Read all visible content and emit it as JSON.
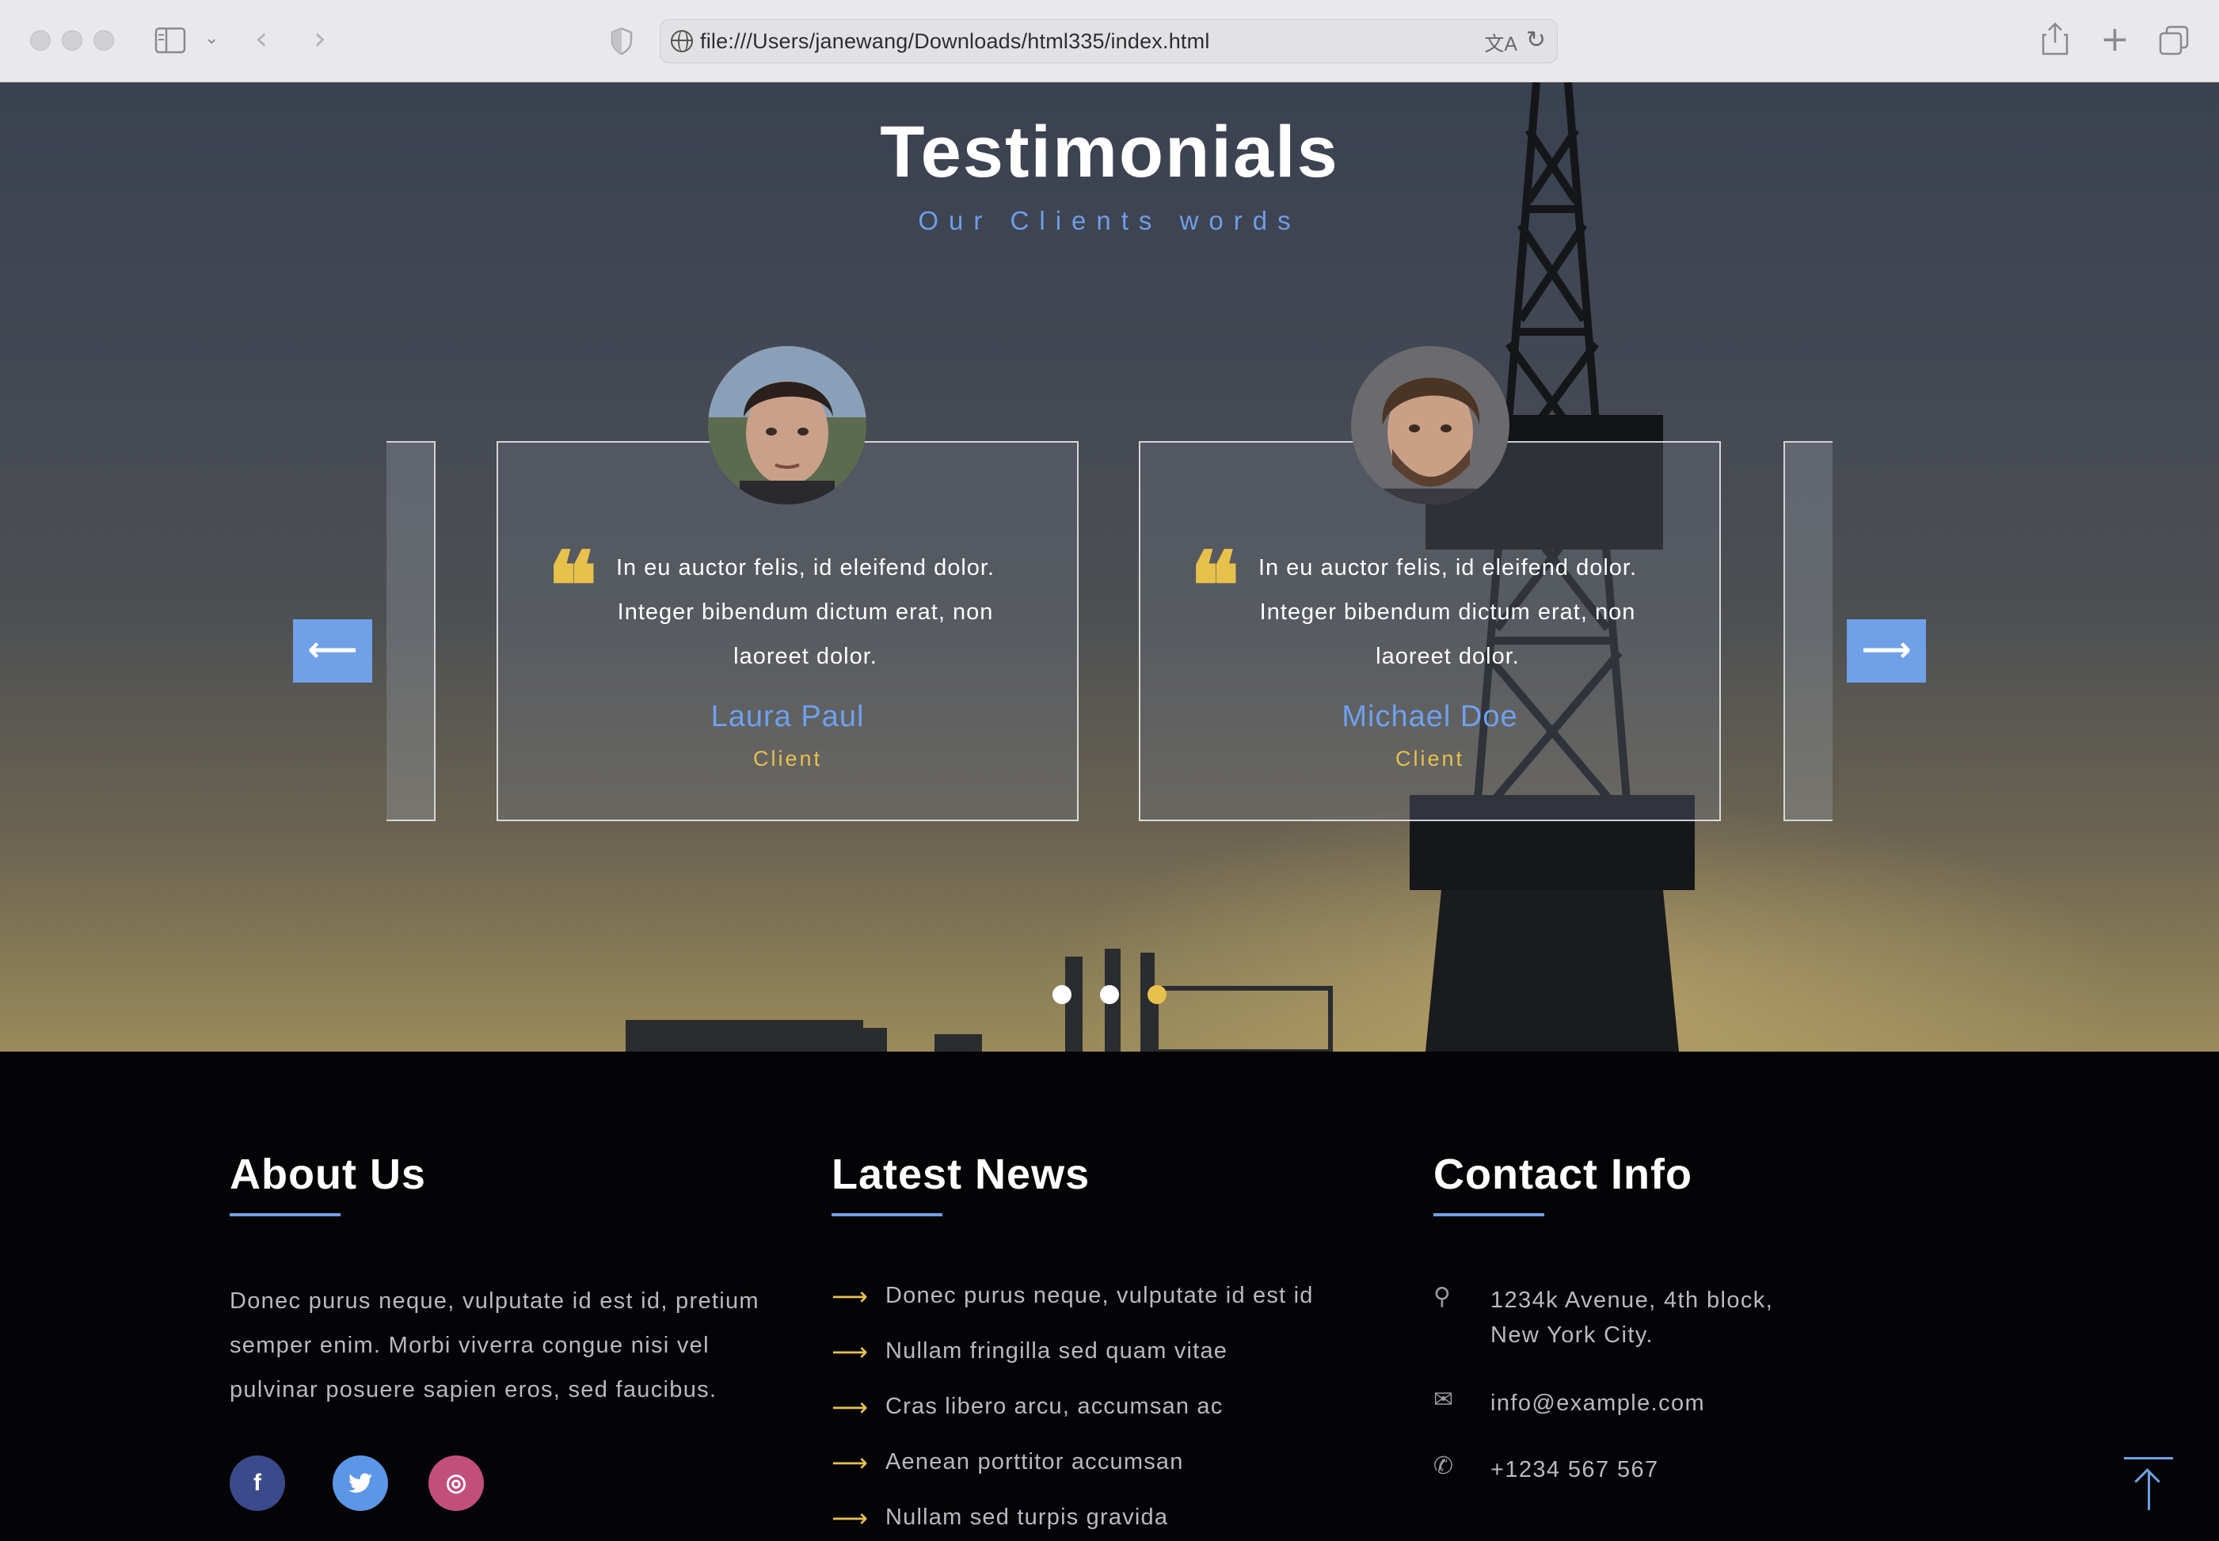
{
  "browser": {
    "url": "file:///Users/janewang/Downloads/html335/index.html"
  },
  "testimonials": {
    "title": "Testimonials",
    "subtitle": "Our Clients words",
    "prev_arrow": "⟵",
    "next_arrow": "⟶",
    "quote_glyph": "❝",
    "items": [
      {
        "text": "In eu auctor felis, id eleifend dolor. Integer bibendum dictum erat, non laoreet dolor.",
        "name": "Laura Paul",
        "role": "Client"
      },
      {
        "text": "In eu auctor felis, id eleifend dolor. Integer bibendum dictum erat, non laoreet dolor.",
        "name": "Michael Doe",
        "role": "Client"
      }
    ],
    "dots_total": 3,
    "dots_active_index": 2
  },
  "footer": {
    "about": {
      "title": "About Us",
      "text": "Donec purus neque, vulputate id est id, pretium semper enim. Morbi viverra congue nisi vel pulvinar posuere sapien eros, sed faucibus.",
      "social": [
        {
          "icon": "facebook-icon",
          "glyph": "f",
          "color": "#3b4a8a"
        },
        {
          "icon": "twitter-icon",
          "glyph": "🐦",
          "color": "#5d96e6"
        },
        {
          "icon": "dribbble-icon",
          "glyph": "◎",
          "color": "#c24f7a"
        }
      ]
    },
    "news": {
      "title": "Latest News",
      "items": [
        "Donec purus neque, vulputate id est id",
        "Nullam fringilla sed quam vitae",
        "Cras libero arcu, accumsan ac",
        "Aenean porttitor accumsan",
        "Nullam sed turpis gravida"
      ]
    },
    "contact": {
      "title": "Contact Info",
      "address_line1": "1234k Avenue, 4th block,",
      "address_line2": "New York City.",
      "email": "info@example.com",
      "phone": "+1234 567 567"
    }
  },
  "colors": {
    "accent": "#6fa0e8",
    "gold": "#e8c14d"
  }
}
